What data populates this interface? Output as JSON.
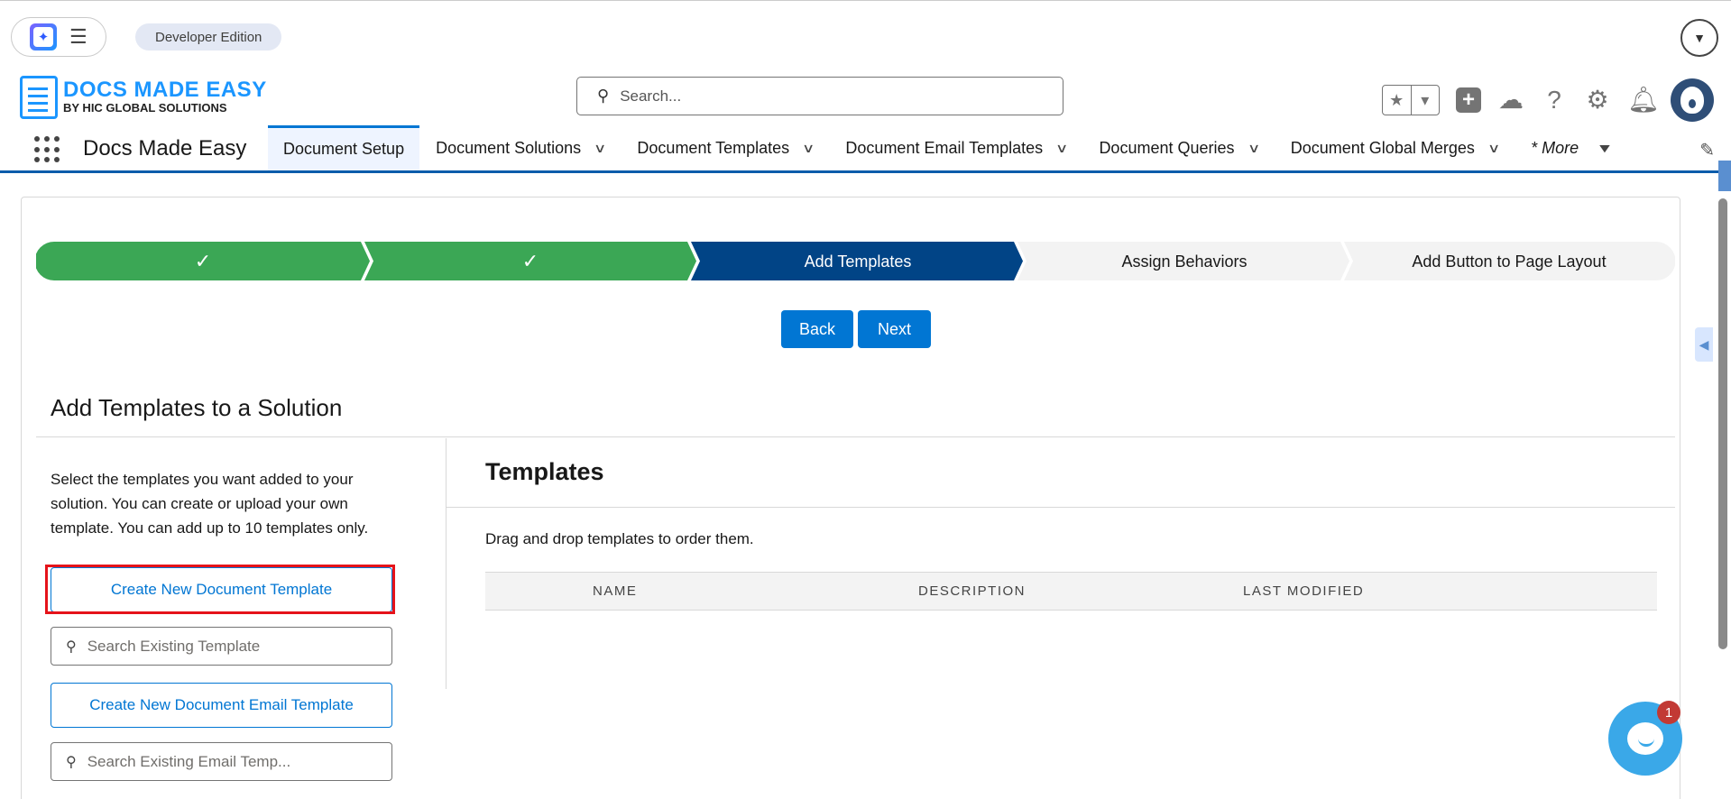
{
  "top_bar": {
    "edition_badge": "Developer Edition"
  },
  "header": {
    "logo_line1": "DOCS MADE EASY",
    "logo_line2": "BY HIC GLOBAL SOLUTIONS",
    "search_placeholder": "Search..."
  },
  "nav": {
    "app_name": "Docs Made Easy",
    "tabs": [
      {
        "label": "Document Setup",
        "active": true
      },
      {
        "label": "Document Solutions"
      },
      {
        "label": "Document Templates"
      },
      {
        "label": "Document Email Templates"
      },
      {
        "label": "Document Queries"
      },
      {
        "label": "Document Global Merges"
      }
    ],
    "more_label": "* More"
  },
  "path": {
    "steps": [
      {
        "label": "✓",
        "state": "done"
      },
      {
        "label": "✓",
        "state": "done"
      },
      {
        "label": "Add Templates",
        "state": "current"
      },
      {
        "label": "Assign Behaviors",
        "state": "todo"
      },
      {
        "label": "Add Button to Page Layout",
        "state": "todo"
      }
    ]
  },
  "actions": {
    "back_label": "Back",
    "next_label": "Next"
  },
  "section": {
    "title": "Add Templates to a Solution",
    "intro": "Select the templates you want added to your solution. You can create or upload your own template. You can add up to 10 templates only.",
    "create_template_label": "Create New Document Template",
    "search_template_placeholder": "Search Existing Template",
    "create_email_template_label": "Create New Document Email Template",
    "search_email_placeholder": "Search Existing Email Temp..."
  },
  "templates": {
    "title": "Templates",
    "note": "Drag and drop templates to order them.",
    "columns": [
      "NAME",
      "DESCRIPTION",
      "LAST MODIFIED"
    ]
  },
  "chat": {
    "badge_count": "1"
  },
  "colors": {
    "brand": "#0176d3",
    "path_done": "#3ba755",
    "path_current": "#014486",
    "highlight": "#e5131a"
  }
}
